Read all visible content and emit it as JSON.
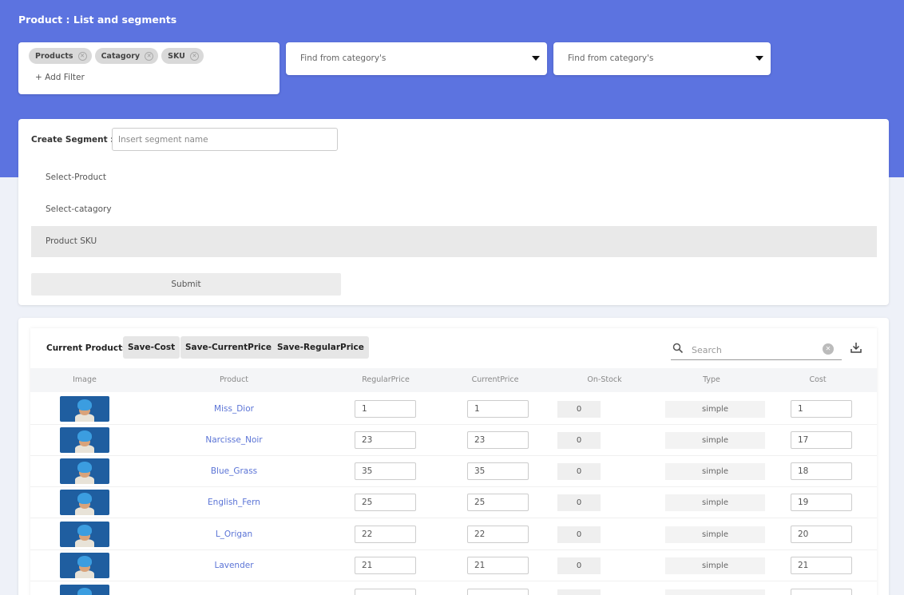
{
  "page_title": "Product : List and segments",
  "filters": {
    "chips": [
      "Products",
      "Catagory",
      "SKU"
    ],
    "add_filter": "+ Add Filter"
  },
  "dropdowns": [
    {
      "placeholder": "Find from category's"
    },
    {
      "placeholder": "Find from category's"
    }
  ],
  "segment": {
    "label": "Create Segment :",
    "input_placeholder": "Insert segment name",
    "options": [
      "Select-Product",
      "Select-catagory",
      "Product SKU"
    ],
    "active_option": "Product SKU",
    "submit_label": "Submit"
  },
  "table": {
    "title": "Current Products",
    "buttons": [
      "Save-Cost",
      "Save-CurrentPrice",
      "Save-RegularPrice"
    ],
    "search_placeholder": "Search",
    "columns": [
      "Image",
      "Product",
      "RegularPrice",
      "CurrentPrice",
      "On-Stock",
      "Type",
      "Cost"
    ],
    "rows": [
      {
        "product": "Miss_Dior",
        "regular_price": "1",
        "current_price": "1",
        "on_stock": "0",
        "type": "simple",
        "cost": "1"
      },
      {
        "product": "Narcisse_Noir",
        "regular_price": "23",
        "current_price": "23",
        "on_stock": "0",
        "type": "simple",
        "cost": "17"
      },
      {
        "product": "Blue_Grass",
        "regular_price": "35",
        "current_price": "35",
        "on_stock": "0",
        "type": "simple",
        "cost": "18"
      },
      {
        "product": "English_Fern",
        "regular_price": "25",
        "current_price": "25",
        "on_stock": "0",
        "type": "simple",
        "cost": "19"
      },
      {
        "product": "L_Origan",
        "regular_price": "22",
        "current_price": "22",
        "on_stock": "0",
        "type": "simple",
        "cost": "20"
      },
      {
        "product": "Lavender",
        "regular_price": "21",
        "current_price": "21",
        "on_stock": "0",
        "type": "simple",
        "cost": "21"
      }
    ]
  },
  "colors": {
    "header_bg": "#5c73e0",
    "product_link": "#5b74d6"
  }
}
